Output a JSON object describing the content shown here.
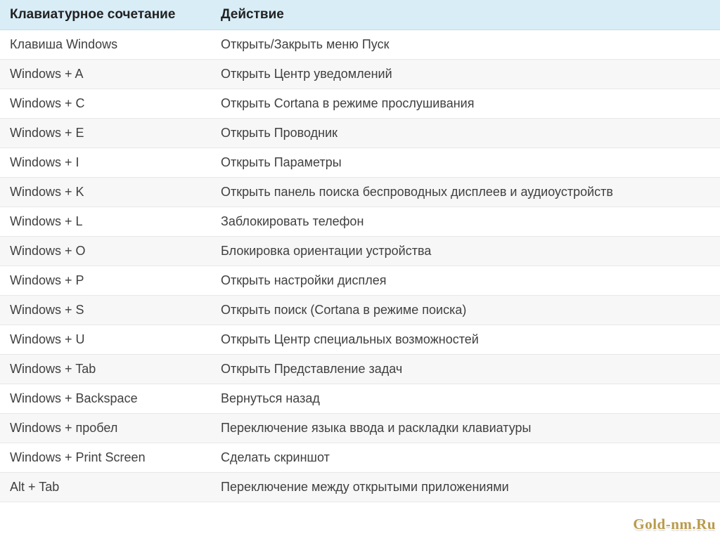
{
  "table": {
    "headers": [
      "Клавиатурное сочетание",
      "Действие"
    ],
    "rows": [
      {
        "shortcut": "Клавиша Windows",
        "action": "Открыть/Закрыть меню Пуск"
      },
      {
        "shortcut": "Windows + A",
        "action": "Открыть Центр уведомлений"
      },
      {
        "shortcut": "Windows + C",
        "action": "Открыть Cortana в режиме прослушивания"
      },
      {
        "shortcut": "Windows + E",
        "action": "Открыть Проводник"
      },
      {
        "shortcut": "Windows + I",
        "action": "Открыть Параметры"
      },
      {
        "shortcut": "Windows + K",
        "action": "Открыть панель поиска беспроводных дисплеев и аудиоустройств"
      },
      {
        "shortcut": "Windows + L",
        "action": "Заблокировать телефон"
      },
      {
        "shortcut": "Windows + O",
        "action": "Блокировка ориентации устройства"
      },
      {
        "shortcut": "Windows + P",
        "action": "Открыть настройки дисплея"
      },
      {
        "shortcut": "Windows + S",
        "action": "Открыть поиск (Cortana в режиме поиска)"
      },
      {
        "shortcut": "Windows + U",
        "action": "Открыть Центр специальных возможностей"
      },
      {
        "shortcut": "Windows + Tab",
        "action": "Открыть Представление задач"
      },
      {
        "shortcut": "Windows + Backspace",
        "action": "Вернуться назад"
      },
      {
        "shortcut": "Windows + пробел",
        "action": "Переключение языка ввода и раскладки клавиатуры"
      },
      {
        "shortcut": "Windows + Print Screen",
        "action": "Сделать скриншот"
      },
      {
        "shortcut": "Alt + Tab",
        "action": "Переключение между открытыми приложениями"
      }
    ]
  },
  "watermark": "Gold-nm.Ru"
}
